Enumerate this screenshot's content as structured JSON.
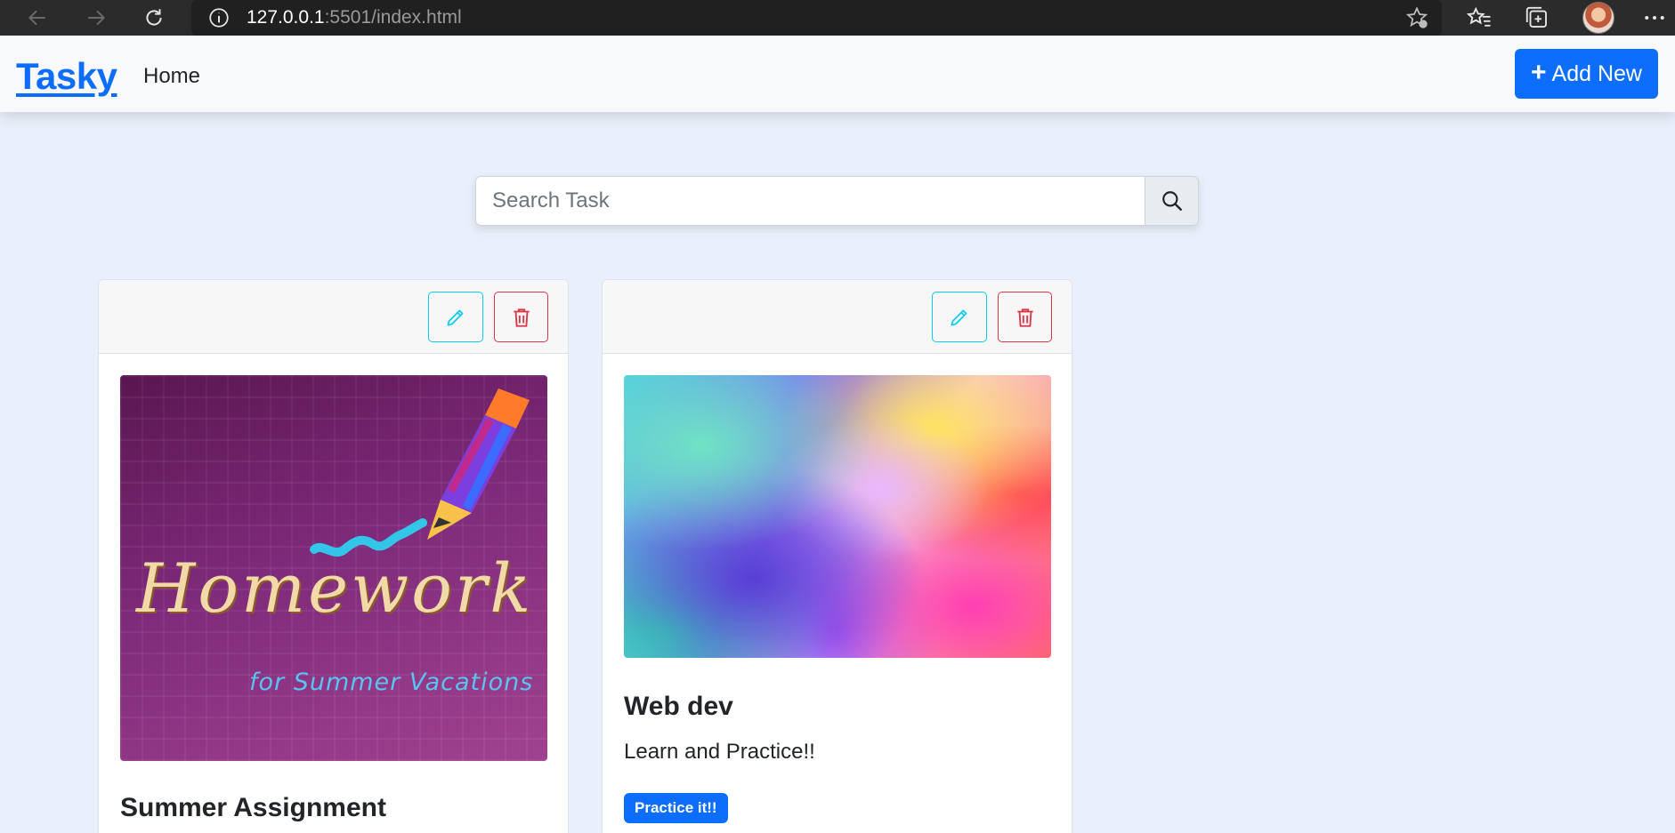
{
  "browser": {
    "url_host": "127.0.0.1",
    "url_path": ":5501/index.html"
  },
  "navbar": {
    "brand": "Tasky",
    "home_link": "Home",
    "add_button_label": "Add New",
    "accent_color": "#0d6efd"
  },
  "search": {
    "placeholder": "Search Task",
    "value": ""
  },
  "cards": [
    {
      "image_text": "Homework",
      "image_subtext": "for Summer Vacations",
      "title": "Summer Assignment"
    },
    {
      "title": "Web dev",
      "description": "Learn and Practice!!",
      "badge": "Practice it!!"
    }
  ]
}
